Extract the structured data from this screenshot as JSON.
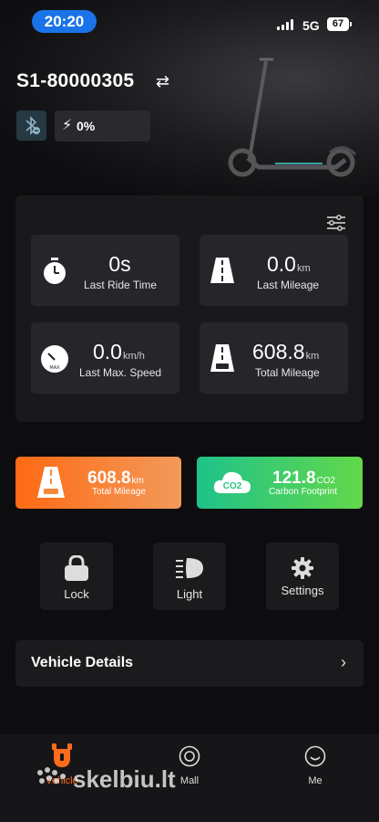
{
  "status_bar": {
    "time": "20:20",
    "network": "5G",
    "battery": "67"
  },
  "vehicle": {
    "id": "S1-80000305",
    "charge": "0%"
  },
  "stats": [
    {
      "value": "0s",
      "unit": "",
      "label": "Last Ride Time",
      "icon": "stopwatch-icon"
    },
    {
      "value": "0.0",
      "unit": "km",
      "label": "Last Mileage",
      "icon": "road-icon"
    },
    {
      "value": "0.0",
      "unit": "km/h",
      "label": "Last Max. Speed",
      "icon": "speedometer-icon"
    },
    {
      "value": "608.8",
      "unit": "km",
      "label": "Total Mileage",
      "icon": "road-icon"
    }
  ],
  "highlights": {
    "mileage": {
      "value": "608.8",
      "unit": "km",
      "label": "Total Mileage",
      "color": "#f37a2e"
    },
    "carbon": {
      "value": "121.8",
      "unit": "CO2",
      "label": "Carbon Footprint",
      "icon_text": "CO2",
      "color": "#2fc775"
    }
  },
  "controls": {
    "lock": "Lock",
    "light": "Light",
    "settings": "Settings"
  },
  "details": {
    "title": "Vehicle Details"
  },
  "nav": {
    "vehicle": "Vehicle",
    "mall": "Mall",
    "me": "Me"
  },
  "watermark": "skelbiu.lt",
  "colors": {
    "accent": "#ff6b1a",
    "time_pill": "#1a73e8"
  }
}
